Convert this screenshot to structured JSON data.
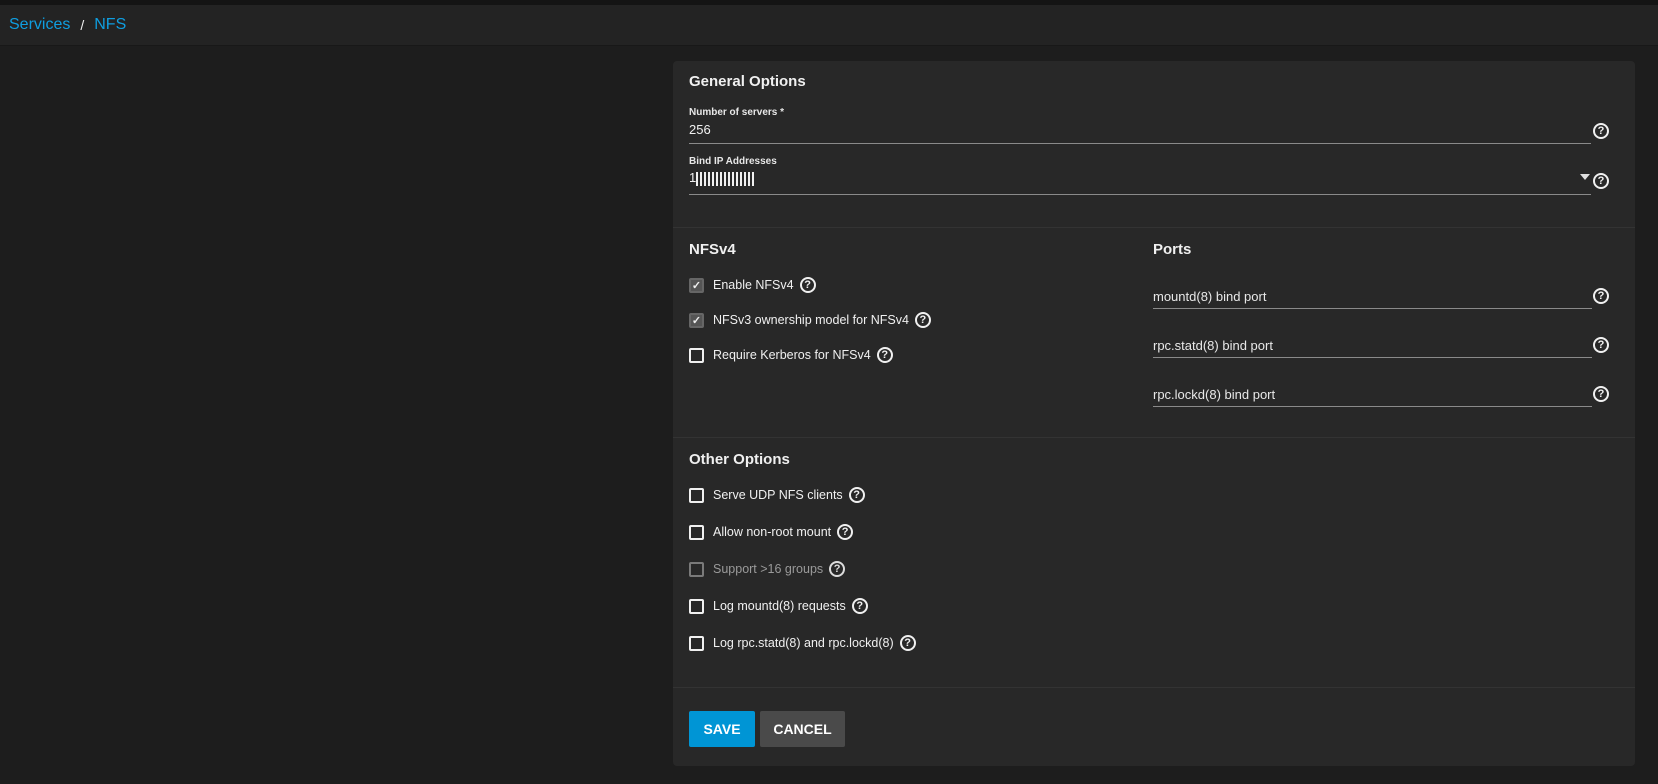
{
  "breadcrumb": {
    "items": [
      "Services",
      "NFS"
    ],
    "separator": "/"
  },
  "general": {
    "title": "General Options",
    "servers": {
      "label": "Number of servers *",
      "value": "256"
    },
    "bind_ip": {
      "label": "Bind IP Addresses",
      "value": "1",
      "value_redacted": true
    }
  },
  "nfsv4": {
    "title": "NFSv4",
    "options": [
      {
        "label": "Enable NFSv4",
        "checked": true
      },
      {
        "label": "NFSv3 ownership model for NFSv4",
        "checked": true
      },
      {
        "label": "Require Kerberos for NFSv4",
        "checked": false
      }
    ]
  },
  "ports": {
    "title": "Ports",
    "fields": [
      {
        "placeholder": "mountd(8) bind port"
      },
      {
        "placeholder": "rpc.statd(8) bind port"
      },
      {
        "placeholder": "rpc.lockd(8) bind port"
      }
    ]
  },
  "other": {
    "title": "Other Options",
    "options": [
      {
        "label": "Serve UDP NFS clients",
        "checked": false,
        "disabled": false
      },
      {
        "label": "Allow non-root mount",
        "checked": false,
        "disabled": false
      },
      {
        "label": "Support >16 groups",
        "checked": false,
        "disabled": true
      },
      {
        "label": "Log mountd(8) requests",
        "checked": false,
        "disabled": false
      },
      {
        "label": "Log rpc.statd(8) and rpc.lockd(8)",
        "checked": false,
        "disabled": false
      }
    ]
  },
  "actions": {
    "save": "SAVE",
    "cancel": "CANCEL"
  },
  "icons": {
    "help": "?"
  },
  "colors": {
    "accent": "#0095d5",
    "link": "#0f9ee0",
    "background": "#1d1d1d",
    "card": "#282828"
  }
}
